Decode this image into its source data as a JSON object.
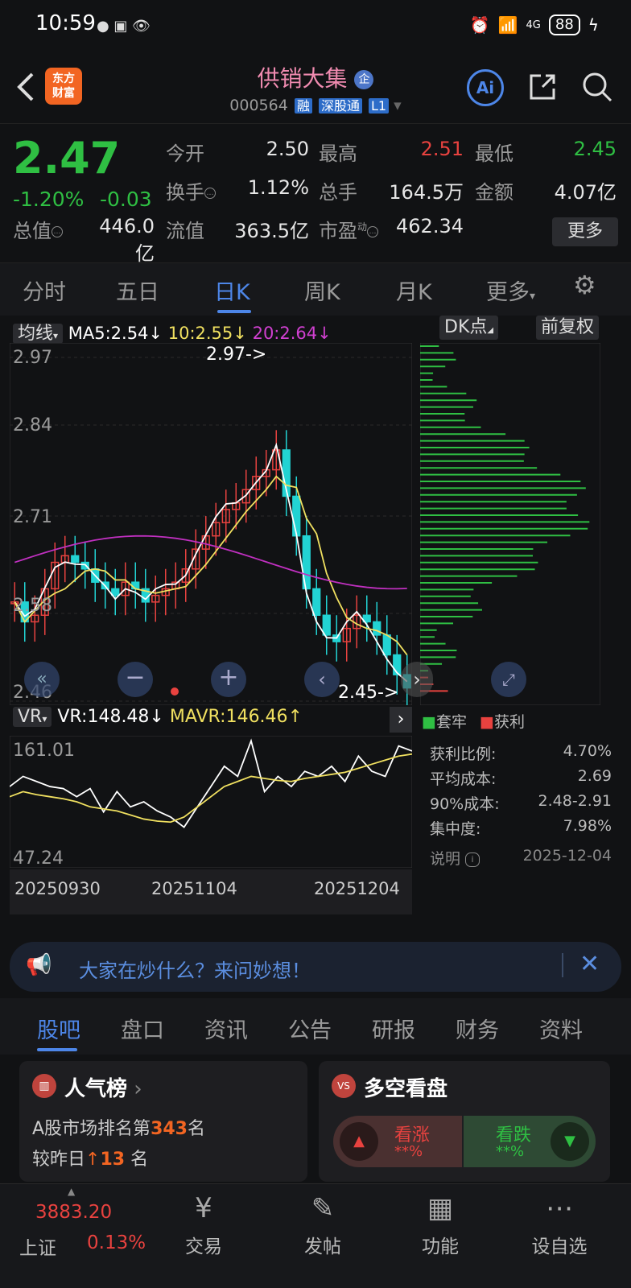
{
  "status": {
    "time": "10:59",
    "battery": "88",
    "network": "4G"
  },
  "header": {
    "logo_line1": "东方",
    "logo_line2": "财富",
    "title": "供销大集",
    "enterprise_badge": "企",
    "code": "000564",
    "tag1": "融",
    "tag2": "深股通",
    "tag3": "L1",
    "ai_label": "Ai"
  },
  "quote": {
    "price": "2.47",
    "change_pct": "-1.20%",
    "change": "-0.03",
    "open_label": "今开",
    "open": "2.50",
    "high_label": "最高",
    "high": "2.51",
    "low_label": "最低",
    "low": "2.45",
    "turnover_label": "换手",
    "turnover": "1.12%",
    "volume_label": "总手",
    "volume": "164.5万",
    "amount_label": "金额",
    "amount": "4.07亿",
    "mktcap_label": "总值",
    "mktcap": "446.0亿",
    "float_label": "流值",
    "float_cap": "363.5亿",
    "pe_label": "市盈",
    "pe_sup": "动",
    "pe": "462.34",
    "more": "更多"
  },
  "ktabs": [
    "分时",
    "五日",
    "日K",
    "周K",
    "月K",
    "更多"
  ],
  "chart": {
    "ma_label": "均线",
    "ma5": "MA5:2.54",
    "ma10": "10:2.55",
    "ma20": "20:2.64",
    "dk_label": "DK点",
    "fq_label": "前复权",
    "y_labels": [
      "2.97",
      "2.84",
      "2.71",
      "2.58",
      "2.46"
    ],
    "max_marker": "2.97->",
    "min_marker": "2.45->",
    "vr_label": "VR",
    "vr": "VR:148.48",
    "mavr": "MAVR:146.46",
    "vr_top": "161.01",
    "vr_bottom": "47.24",
    "dates": [
      "20250930",
      "20251104",
      "20251204"
    ],
    "legend_trapped": "套牢",
    "legend_profit": "获利",
    "chip": [
      {
        "label": "获利比例:",
        "value": "4.70%"
      },
      {
        "label": "平均成本:",
        "value": "2.69"
      },
      {
        "label": "90%成本:",
        "value": "2.48-2.91"
      },
      {
        "label": "集中度:",
        "value": "7.98%"
      }
    ],
    "note_label": "说明",
    "note_date": "2025-12-04"
  },
  "banner": {
    "text": "大家在炒什么？来问妙想！"
  },
  "btabs": [
    "股吧",
    "盘口",
    "资讯",
    "公告",
    "研报",
    "财务",
    "资料"
  ],
  "popularity": {
    "title": "人气榜",
    "rank_prefix": "A股市场排名第",
    "rank": "343",
    "rank_suffix": "名",
    "change_prefix": "较昨日",
    "change": "13",
    "change_suffix": "名"
  },
  "longshort": {
    "title": "多空看盘",
    "up_label": "看涨",
    "up_value": "**%",
    "down_label": "看跌",
    "down_value": "**%"
  },
  "bottom_nav": {
    "index_value": "3883.20",
    "index_name": "上证",
    "index_change": "0.13%",
    "items": [
      "交易",
      "发帖",
      "功能",
      "设自选"
    ]
  }
}
